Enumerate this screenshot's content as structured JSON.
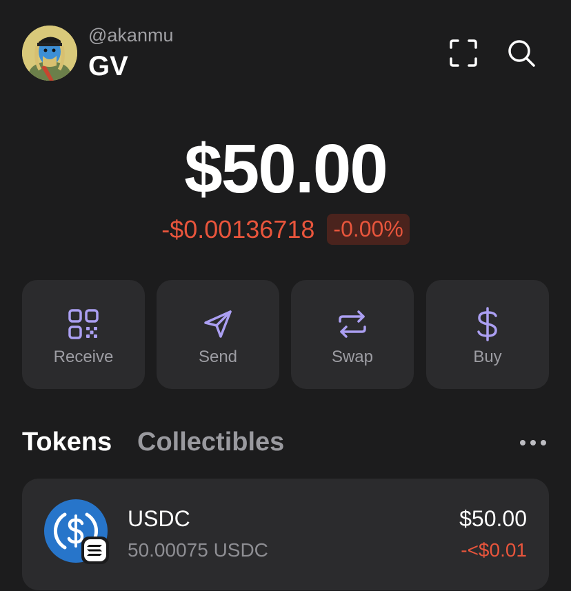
{
  "account": {
    "handle": "@akanmu",
    "name": "GV"
  },
  "header": {
    "scan_icon": "scan-qr-icon",
    "search_icon": "search-icon"
  },
  "balance": {
    "total": "$50.00",
    "change_amount": "-$0.00136718",
    "change_percent": "-0.00%"
  },
  "actions": [
    {
      "label": "Receive",
      "icon": "qr-code-icon"
    },
    {
      "label": "Send",
      "icon": "paper-plane-icon"
    },
    {
      "label": "Swap",
      "icon": "swap-arrows-icon"
    },
    {
      "label": "Buy",
      "icon": "dollar-icon"
    }
  ],
  "tabs": {
    "tokens": "Tokens",
    "collectibles": "Collectibles",
    "active": "Tokens"
  },
  "tokens": [
    {
      "name": "USDC",
      "quantity": "50.00075 USDC",
      "value": "$50.00",
      "change": "-<$0.01",
      "icon": "usdc-logo",
      "network_icon": "solana-badge"
    }
  ],
  "colors": {
    "background": "#1c1c1d",
    "card": "#2b2b2d",
    "accent": "#ab9ff2",
    "negative": "#e8553c",
    "negative_bg": "#4a231d"
  }
}
